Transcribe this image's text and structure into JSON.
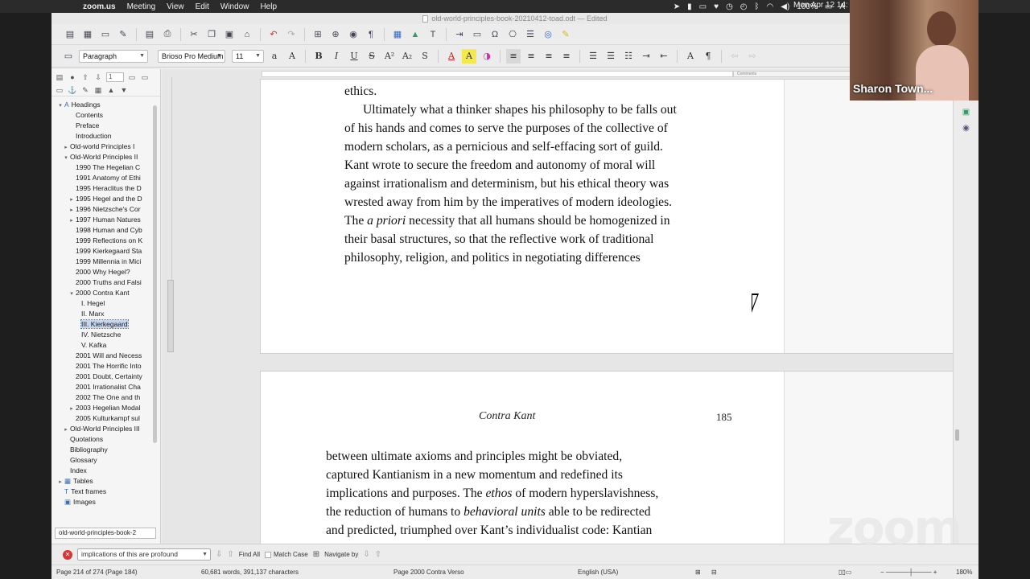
{
  "menubar": {
    "app_name": "zoom.us",
    "menus": [
      "Meeting",
      "View",
      "Edit",
      "Window",
      "Help"
    ],
    "battery": "100%",
    "clock": "Mon Apr 12 14:",
    "input_source": "A"
  },
  "window": {
    "title": "old-world-principles-book-20210412-toad.odt — Edited"
  },
  "formatbar": {
    "paragraph_style": "Paragraph",
    "font_name": "Brioso Pro Medium",
    "font_size": "11"
  },
  "navigator": {
    "page_field": "1",
    "document_select": "old-world-principles-book-2",
    "items": [
      {
        "label": "Headings",
        "indent": 0,
        "toggle": "▾",
        "icon": "A"
      },
      {
        "label": "Contents",
        "indent": 2,
        "toggle": ""
      },
      {
        "label": "Preface",
        "indent": 2,
        "toggle": ""
      },
      {
        "label": "Introduction",
        "indent": 2,
        "toggle": ""
      },
      {
        "label": "Old-world Principles I",
        "indent": 1,
        "toggle": "▸"
      },
      {
        "label": "Old-World Principles II",
        "indent": 1,
        "toggle": "▾"
      },
      {
        "label": "1990 The Hegelian C",
        "indent": 2,
        "toggle": ""
      },
      {
        "label": "1991 Anatomy of Ethi",
        "indent": 2,
        "toggle": ""
      },
      {
        "label": "1995 Heraclitus the D",
        "indent": 2,
        "toggle": ""
      },
      {
        "label": "1995 Hegel and the D",
        "indent": 2,
        "toggle": "▸"
      },
      {
        "label": "1996 Nietzsche's Cor",
        "indent": 2,
        "toggle": "▸"
      },
      {
        "label": "1997 Human Natures",
        "indent": 2,
        "toggle": "▸"
      },
      {
        "label": "1998 Human and Cyb",
        "indent": 2,
        "toggle": ""
      },
      {
        "label": "1999 Reflections on K",
        "indent": 2,
        "toggle": ""
      },
      {
        "label": "1999 Kierkegaard Sta",
        "indent": 2,
        "toggle": ""
      },
      {
        "label": "1999 Millennia in Mici",
        "indent": 2,
        "toggle": ""
      },
      {
        "label": "2000 Why Hegel?",
        "indent": 2,
        "toggle": ""
      },
      {
        "label": "2000 Truths and Falsi",
        "indent": 2,
        "toggle": ""
      },
      {
        "label": "2000 Contra Kant",
        "indent": 2,
        "toggle": "▾"
      },
      {
        "label": "I. Hegel",
        "indent": 3,
        "toggle": ""
      },
      {
        "label": "II. Marx",
        "indent": 3,
        "toggle": ""
      },
      {
        "label": "III. Kierkegaard",
        "indent": 3,
        "toggle": "",
        "selected": true
      },
      {
        "label": "IV. Nietzsche",
        "indent": 3,
        "toggle": ""
      },
      {
        "label": "V. Kafka",
        "indent": 3,
        "toggle": ""
      },
      {
        "label": "2001 Will and Necess",
        "indent": 2,
        "toggle": ""
      },
      {
        "label": "2001 The Horrific Into",
        "indent": 2,
        "toggle": ""
      },
      {
        "label": "2001 Doubt, Certainty",
        "indent": 2,
        "toggle": ""
      },
      {
        "label": "2001 Irrationalist Cha",
        "indent": 2,
        "toggle": ""
      },
      {
        "label": "2002 The One and th",
        "indent": 2,
        "toggle": ""
      },
      {
        "label": "2003 Hegelian Modal",
        "indent": 2,
        "toggle": "▸"
      },
      {
        "label": "2005 Kulturkampf sul",
        "indent": 2,
        "toggle": ""
      },
      {
        "label": "Old-World Principles III",
        "indent": 1,
        "toggle": "▸"
      },
      {
        "label": "Quotations",
        "indent": 1,
        "toggle": ""
      },
      {
        "label": "Bibliography",
        "indent": 1,
        "toggle": ""
      },
      {
        "label": "Glossary",
        "indent": 1,
        "toggle": ""
      },
      {
        "label": "Index",
        "indent": 1,
        "toggle": ""
      },
      {
        "label": "Tables",
        "indent": 0,
        "toggle": "▸",
        "icon": "▦"
      },
      {
        "label": "Text frames",
        "indent": 0,
        "toggle": "",
        "icon": "T"
      },
      {
        "label": "Images",
        "indent": 0,
        "toggle": "",
        "icon": "▣"
      }
    ]
  },
  "ruler": {
    "comments_label": "Comments"
  },
  "page1": {
    "first_line": "ethics.",
    "lines": [
      "Ultimately what a thinker shapes his philosophy to be falls out",
      "of his hands and comes to serve the purposes of the collective of",
      "modern scholars, as a pernicious and self-effacing sort of guild.",
      "Kant wrote to secure the freedom and autonomy of moral will",
      "against irrationalism and determinism, but his ethical theory was",
      "wrested away from him by the imperatives of modern ideologies."
    ],
    "line7_pre": "The ",
    "line7_italic": "a priori",
    "line7_post": " necessity that all humans should be homogenized in",
    "lines_end": [
      "their basal structures, so that the reflective work of traditional",
      "philosophy, religion, and politics in negotiating differences"
    ]
  },
  "page2": {
    "running_head": "Contra Kant",
    "page_number": "185",
    "line1": "between ultimate axioms and principles might be obviated,",
    "line2": "captured Kantianism in a new momentum and redefined its",
    "line3_pre": "implications and purposes. The ",
    "line3_italic": "ethos",
    "line3_post": " of modern hyperslavishness,",
    "line4_pre": "the reduction of humans to ",
    "line4_italic": "behavioral units",
    "line4_post": " able to be redirected",
    "line5": "and predicted, triumphed over Kant’s individualist code: Kantian"
  },
  "findbar": {
    "search_value": "implications of this are profound",
    "find_all": "Find All",
    "match_case": "Match Case",
    "navigate_by": "Navigate by"
  },
  "statusbar": {
    "page_info": "Page 214 of 274 (Page 184)",
    "word_count": "60,681 words, 391,137 characters",
    "page_style": "Page 2000 Contra Verso",
    "language": "English (USA)",
    "zoom": "180%"
  },
  "video": {
    "participant_name": "Sharon Town..."
  },
  "zoom_watermark": "zoom"
}
